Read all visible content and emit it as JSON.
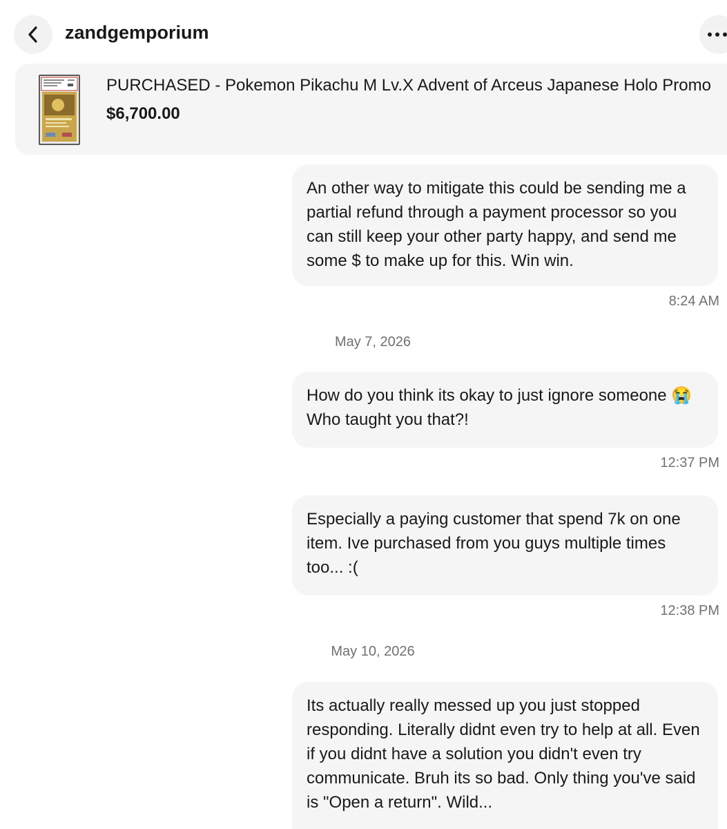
{
  "header": {
    "seller_name": "zandgemporium",
    "back_icon": "chevron-left-icon",
    "more_icon": "more-horizontal-icon"
  },
  "item": {
    "title": "PURCHASED - Pokemon Pikachu M Lv.X Advent of Arceus Japanese Holo Promo",
    "price": "$6,700.00",
    "thumbnail": "graded-card-slab-image"
  },
  "conversation": {
    "m1": {
      "text": "An other way to mitigate this could be sending me a partial refund through a payment processor so you can still keep your other party happy, and send me some $ to make up for this. Win win.",
      "time": "8:24 AM"
    },
    "date1": "May 7, 2026",
    "m2": {
      "text": "How do you think its okay to just ignore someone 😭 Who taught you that?!",
      "time": "12:37 PM"
    },
    "m3": {
      "text": "Especially a paying customer that spend 7k on one item. Ive purchased from you guys multiple times too... :(",
      "time": "12:38 PM"
    },
    "date2": "May 10, 2026",
    "m4": {
      "text": "Its actually really messed up you just stopped responding. Literally didnt even try to help at all. Even if you didnt have a solution you didn't even try communicate. Bruh its so bad. Only thing you've said is \"Open a return\". Wild..."
    }
  },
  "colors": {
    "bubble_bg": "#f5f5f5",
    "card_bg": "#f5f5f5",
    "text": "#191919",
    "muted": "#707070"
  }
}
